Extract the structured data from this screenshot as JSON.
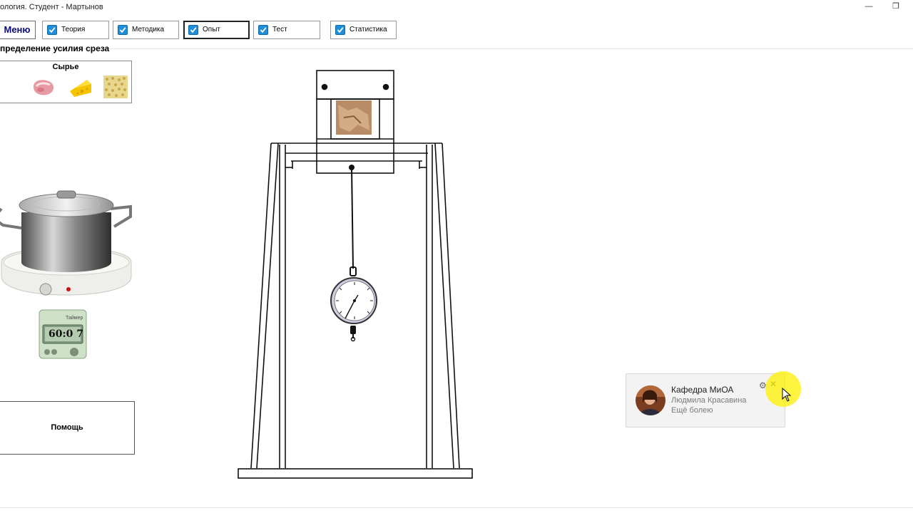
{
  "window": {
    "title": "ология. Студент - Мартынов",
    "minimize_label": "—",
    "restore_label": "❐"
  },
  "toolbar": {
    "menu_label": "Меню",
    "tabs": [
      {
        "label": "Теория",
        "checked": true,
        "active": false
      },
      {
        "label": "Методика",
        "checked": true,
        "active": false
      },
      {
        "label": "Опыт",
        "checked": true,
        "active": true
      },
      {
        "label": "Тест",
        "checked": true,
        "active": false
      },
      {
        "label": "Статистика",
        "checked": true,
        "active": false
      }
    ]
  },
  "left_panel": {
    "section_title": "пределение усилия среза",
    "raw_materials": {
      "title": "Сырье",
      "items": [
        "meat-icon",
        "cheese-icon",
        "grain-icon"
      ]
    },
    "stove_icon": "pot-on-stove-icon",
    "timer": {
      "label": "Таймер",
      "display": "60:0 7"
    },
    "help_label": "Помощь"
  },
  "apparatus": {
    "icon": "shear-press-apparatus",
    "gauge_icon": "dynamometer-dial-icon"
  },
  "notification": {
    "title": "Кафедра МиОА",
    "sender": "Людмила Красавина",
    "message": "Ещё болею",
    "settings_icon": "gear-icon",
    "close_icon": "close-icon"
  },
  "colors": {
    "checkbox": "#1e8fd8",
    "menu_text": "#0b0b7a",
    "cursor_highlight": "#fff000",
    "toast_bg": "#f3f3f3"
  }
}
